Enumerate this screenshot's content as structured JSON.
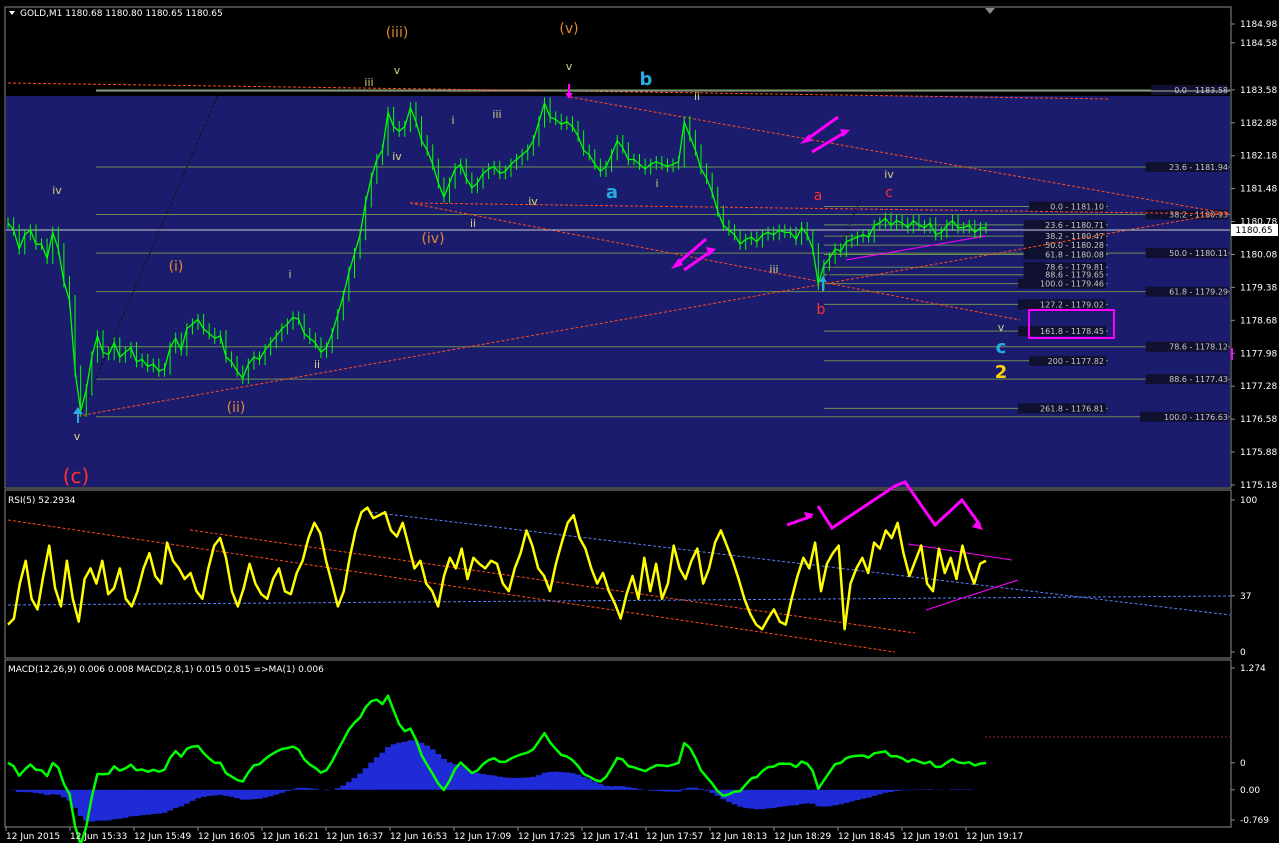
{
  "window": {
    "header": "GOLD,M1  1180.68 1180.80 1180.65 1180.65",
    "current_price": "1180.65"
  },
  "colors": {
    "background": "#000000",
    "price_panel_bg": "#1c1c6e",
    "candle": "#00ff00",
    "rsi_line": "#ffff00",
    "macd_line": "#00ff00",
    "histogram": "#1e2bd6",
    "magenta": "#ff00ff",
    "orange": "#e08a2c",
    "red_label": "#ff3030",
    "blue_label": "#29abe2",
    "yellow_label": "#ffd400",
    "trend_red": "#ff4a1f",
    "trend_blue": "#5a7dff",
    "fib_grid": "#6b8f4e"
  },
  "chart_data": [
    {
      "type": "line",
      "panel": "price",
      "title": "GOLD,M1",
      "ylim": [
        1175.18,
        1184.98
      ],
      "y_ticks": [
        "1184.98",
        "1184.58",
        "1183.58",
        "1182.88",
        "1182.18",
        "1181.48",
        "1180.78",
        "1180.08",
        "1179.38",
        "1178.68",
        "1177.98",
        "1177.28",
        "1176.58",
        "1175.88",
        "1175.18"
      ],
      "x_ticks": [
        "12 Jun 2015",
        "12 Jun 15:33",
        "12 Jun 15:49",
        "12 Jun 16:05",
        "12 Jun 16:21",
        "12 Jun 16:37",
        "12 Jun 16:53",
        "12 Jun 17:09",
        "12 Jun 17:25",
        "12 Jun 17:41",
        "12 Jun 17:57",
        "12 Jun 18:13",
        "12 Jun 18:29",
        "12 Jun 18:45",
        "12 Jun 19:01",
        "12 Jun 19:17"
      ],
      "series": [
        {
          "values": [
            1180.75,
            1180.6,
            1180.2,
            1180.5,
            1180.6,
            1180.3,
            1180.3,
            1180.0,
            1180.55,
            1180.2,
            1179.5,
            1179.1,
            1177.6,
            1176.75,
            1177.2,
            1177.9,
            1178.35,
            1178.0,
            1177.95,
            1178.2,
            1177.9,
            1178.0,
            1178.1,
            1177.8,
            1177.85,
            1177.7,
            1177.75,
            1177.6,
            1177.65,
            1178.1,
            1178.3,
            1178.05,
            1178.5,
            1178.6,
            1178.7,
            1178.5,
            1178.4,
            1178.3,
            1178.35,
            1177.9,
            1177.8,
            1177.6,
            1177.45,
            1177.75,
            1177.9,
            1177.85,
            1178.05,
            1178.2,
            1178.35,
            1178.5,
            1178.6,
            1178.75,
            1178.7,
            1178.4,
            1178.3,
            1178.2,
            1178.0,
            1178.1,
            1178.4,
            1178.8,
            1179.2,
            1179.7,
            1180.1,
            1180.5,
            1181.2,
            1181.7,
            1182.1,
            1182.3,
            1183.1,
            1182.8,
            1182.7,
            1182.8,
            1183.2,
            1182.9,
            1182.5,
            1182.3,
            1182.0,
            1181.6,
            1181.3,
            1181.6,
            1181.9,
            1182.0,
            1181.7,
            1181.5,
            1181.6,
            1181.8,
            1181.9,
            1181.95,
            1181.8,
            1181.85,
            1182.0,
            1182.1,
            1182.2,
            1182.3,
            1182.5,
            1182.9,
            1183.3,
            1183.0,
            1182.95,
            1182.85,
            1182.9,
            1182.8,
            1182.6,
            1182.3,
            1182.2,
            1182.0,
            1181.85,
            1181.95,
            1182.2,
            1182.5,
            1182.35,
            1182.1,
            1182.1,
            1182.0,
            1181.9,
            1182.0,
            1182.05,
            1182.0,
            1181.95,
            1182.0,
            1182.05,
            1182.9,
            1182.6,
            1182.3,
            1181.9,
            1181.7,
            1181.4,
            1181.0,
            1180.7,
            1180.6,
            1180.5,
            1180.3,
            1180.4,
            1180.45,
            1180.35,
            1180.5,
            1180.55,
            1180.5,
            1180.6,
            1180.55,
            1180.55,
            1180.4,
            1180.65,
            1180.5,
            1180.2,
            1179.45,
            1179.85,
            1180.0,
            1180.2,
            1180.15,
            1180.35,
            1180.4,
            1180.45,
            1180.5,
            1180.45,
            1180.7,
            1180.75,
            1180.85,
            1180.7,
            1180.8,
            1180.75,
            1180.65,
            1180.8,
            1180.7,
            1180.65,
            1180.75,
            1180.5,
            1180.55,
            1180.7,
            1180.8,
            1180.65,
            1180.65,
            1180.7,
            1180.55,
            1180.65,
            1180.65
          ]
        }
      ]
    },
    {
      "type": "line",
      "panel": "rsi",
      "title": "RSI(5) 52.2934",
      "ylim": [
        0,
        100
      ],
      "y_ticks": [
        "100",
        "37",
        "0"
      ],
      "series": [
        {
          "values": [
            18,
            22,
            45,
            60,
            35,
            28,
            50,
            70,
            42,
            30,
            60,
            35,
            20,
            48,
            55,
            45,
            60,
            38,
            42,
            55,
            35,
            30,
            40,
            55,
            65,
            50,
            45,
            72,
            60,
            55,
            48,
            52,
            40,
            35,
            55,
            70,
            75,
            62,
            40,
            30,
            42,
            58,
            45,
            38,
            35,
            48,
            55,
            40,
            38,
            52,
            60,
            75,
            85,
            78,
            60,
            45,
            30,
            40,
            62,
            80,
            92,
            95,
            88,
            90,
            92,
            80,
            76,
            85,
            70,
            55,
            60,
            45,
            40,
            30,
            50,
            62,
            55,
            68,
            48,
            62,
            58,
            55,
            60,
            58,
            45,
            40,
            55,
            65,
            80,
            70,
            55,
            50,
            40,
            58,
            72,
            85,
            90,
            75,
            68,
            55,
            45,
            52,
            40,
            32,
            22,
            38,
            50,
            35,
            62,
            40,
            58,
            35,
            45,
            70,
            55,
            48,
            60,
            68,
            45,
            55,
            72,
            80,
            70,
            60,
            48,
            35,
            25,
            18,
            15,
            22,
            28,
            20,
            18,
            35,
            50,
            62,
            55,
            72,
            40,
            58,
            65,
            70,
            15,
            45,
            55,
            62,
            52,
            72,
            68,
            80,
            75,
            85,
            65,
            50,
            60,
            70,
            45,
            40,
            68,
            52,
            62,
            48,
            70,
            55,
            45,
            58,
            60
          ]
        }
      ]
    },
    {
      "type": "area",
      "panel": "macd",
      "title": "MACD(12,26,9) 0.006 0.008  MACD(2,8,1) 0.015 0.015  =>MA(1) 0.006",
      "ylim": [
        -0.769,
        1.274
      ],
      "y_ticks": [
        "1.274",
        "0",
        "0.00",
        "-0.769"
      ]
    }
  ],
  "labels": {
    "wave_c": "(c)",
    "wave_i": "(i)",
    "wave_ii": "(ii)",
    "wave_iii": "(iii)",
    "wave_iv": "(iv)",
    "wave_v": "(v)",
    "a_blue": "a",
    "b_blue": "b",
    "c_blue": "c",
    "two": "2",
    "a_red": "a",
    "b_red": "b",
    "c_red": "c",
    "sub_i": "i",
    "sub_ii": "ii",
    "sub_iii": "iii",
    "sub_iv": "iv",
    "sub_v": "v"
  },
  "fib_levels": [
    {
      "text": "0.0 - 1183.58",
      "price": 1183.58
    },
    {
      "text": "23.6 - 1181.94",
      "price": 1181.94
    },
    {
      "text": "38.2 - 1180.93",
      "price": 1180.93
    },
    {
      "text": "50.0 - 1180.11",
      "price": 1180.11
    },
    {
      "text": "61.8 - 1179.29",
      "price": 1179.29
    },
    {
      "text": "78.6 - 1178.12",
      "price": 1178.12
    },
    {
      "text": "88.6 - 1177.43",
      "price": 1177.43
    },
    {
      "text": "100.0 - 1176.63",
      "price": 1176.63
    }
  ],
  "fib_levels_2": [
    {
      "text": "0.0 - 1181.10",
      "price": 1181.1
    },
    {
      "text": "23.6 - 1180.71",
      "price": 1180.71
    },
    {
      "text": "38.2 - 1180.47",
      "price": 1180.47
    },
    {
      "text": "50.0 - 1180.28",
      "price": 1180.28
    },
    {
      "text": "61.8 - 1180.08",
      "price": 1180.08
    },
    {
      "text": "78.6 - 1179.81",
      "price": 1179.81
    },
    {
      "text": "88.6 - 1179.65",
      "price": 1179.65
    },
    {
      "text": "100.0 - 1179.46",
      "price": 1179.46
    },
    {
      "text": "127.2 - 1179.02",
      "price": 1179.02
    },
    {
      "text": "161.8 - 1178.45",
      "price": 1178.45
    },
    {
      "text": "200 - 1177.82",
      "price": 1177.82
    },
    {
      "text": "261.8 - 1176.81",
      "price": 1176.81
    }
  ]
}
